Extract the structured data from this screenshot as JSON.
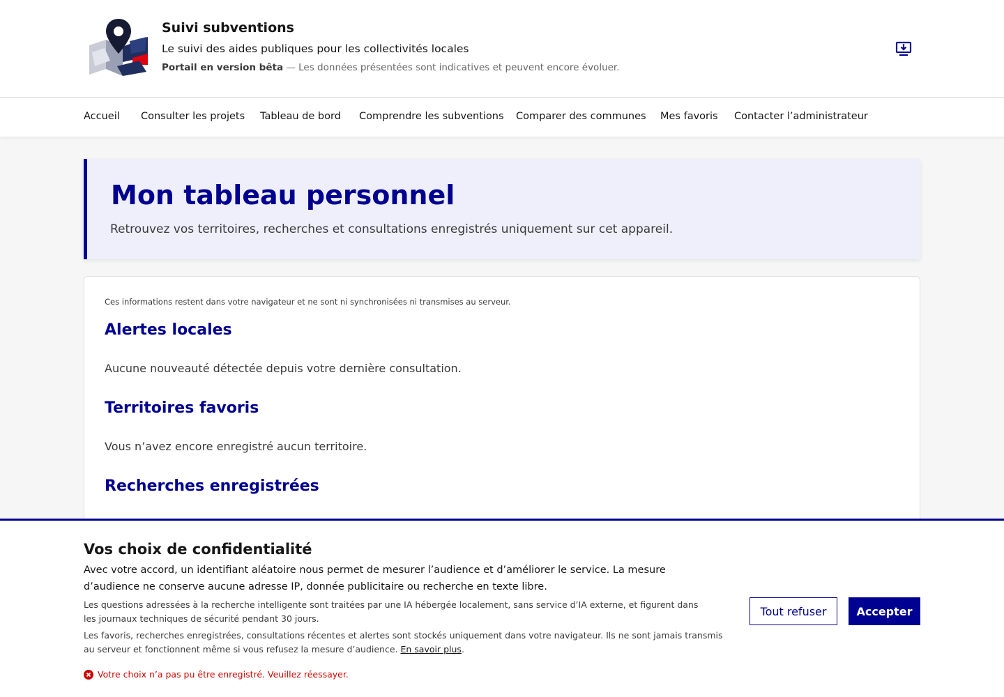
{
  "header": {
    "logo_icon": "map-pin-logo-icon",
    "title": "Suivi subventions",
    "tagline": "Le suivi des aides publiques pour les collectivités locales",
    "beta_label": "Portail en version bêta",
    "beta_text": " — Les données présentées sont indicatives et peuvent encore évoluer.",
    "install_icon": "install-app-icon"
  },
  "nav": {
    "items": [
      {
        "label": "Accueil"
      },
      {
        "label": "Consulter les projets"
      },
      {
        "label": "Tableau de bord"
      },
      {
        "label": "Comprendre les subventions"
      },
      {
        "label": "Comparer des communes"
      },
      {
        "label": "Mes favoris"
      },
      {
        "label": "Contacter l’administrateur"
      }
    ]
  },
  "hero": {
    "title": "Mon tableau personnel",
    "subtitle": "Retrouvez vos territoires, recherches et consultations enregistrés uniquement sur cet appareil."
  },
  "main": {
    "note": "Ces informations restent dans votre navigateur et ne sont ni synchronisées ni transmises au serveur.",
    "sections": [
      {
        "title": "Alertes locales",
        "text": "Aucune nouveauté détectée depuis votre dernière consultation."
      },
      {
        "title": "Territoires favoris",
        "text": "Vous n’avez encore enregistré aucun territoire."
      },
      {
        "title": "Recherches enregistrées",
        "text": ""
      }
    ]
  },
  "consent": {
    "title": "Vos choix de confidentialité",
    "p1": "Avec votre accord, un identifiant aléatoire nous permet de mesurer l’audience et d’améliorer le service. La mesure d’audience ne conserve aucune adresse IP, donnée publicitaire ou recherche en texte libre.",
    "p2": "Les questions adressées à la recherche intelligente sont traitées par une IA hébergée localement, sans service d’IA externe, et figurent dans les journaux techniques de sécurité pendant 30 jours.",
    "p3": "Les favoris, recherches enregistrées, consultations récentes et alertes sont stockés uniquement dans votre navigateur. Ils ne sont jamais transmis au serveur et fonctionnent même si vous refusez la mesure d’audience.",
    "learn_more": "En savoir plus",
    "period": ".",
    "refuse_label": "Tout refuser",
    "accept_label": "Accepter",
    "error": "Votre choix n’a pas pu être enregistré. Veuillez réessayer.",
    "error_icon": "error-circle-icon"
  },
  "colors": {
    "primary": "#000091",
    "error": "#ce0500",
    "hero_bg": "#efeffb",
    "flag_red": "#e1000f"
  }
}
